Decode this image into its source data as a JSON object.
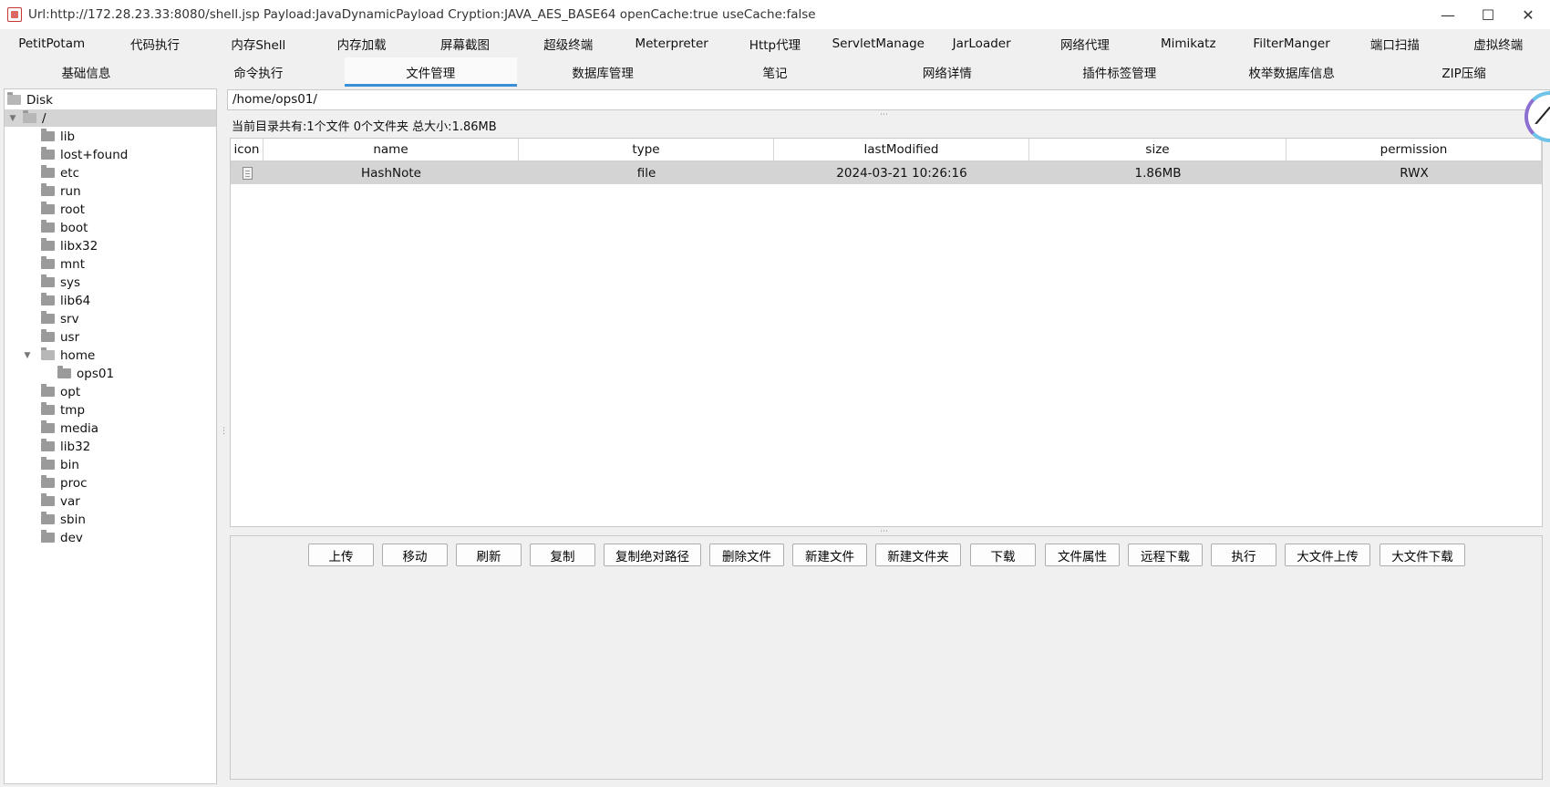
{
  "window": {
    "title": "Url:http://172.28.23.33:8080/shell.jsp Payload:JavaDynamicPayload Cryption:JAVA_AES_BASE64 openCache:true useCache:false"
  },
  "toolbar_row1": [
    "PetitPotam",
    "代码执行",
    "内存Shell",
    "内存加载",
    "屏幕截图",
    "超级终端",
    "Meterpreter",
    "Http代理",
    "ServletManage",
    "JarLoader",
    "网络代理",
    "Mimikatz",
    "FilterManger",
    "端口扫描",
    "虚拟终端"
  ],
  "toolbar_row2": [
    "基础信息",
    "命令执行",
    "文件管理",
    "数据库管理",
    "笔记",
    "网络详情",
    "插件标签管理",
    "枚举数据库信息",
    "ZIP压缩"
  ],
  "active_tab": "文件管理",
  "tree": {
    "root": "Disk",
    "slash": "/",
    "folders": [
      "lib",
      "lost+found",
      "etc",
      "run",
      "root",
      "boot",
      "libx32",
      "mnt",
      "sys",
      "lib64",
      "srv",
      "usr",
      "home",
      "ops01",
      "opt",
      "tmp",
      "media",
      "lib32",
      "bin",
      "proc",
      "var",
      "sbin",
      "dev"
    ]
  },
  "path": "/home/ops01/",
  "summary": "当前目录共有:1个文件 0个文件夹 总大小:1.86MB",
  "table": {
    "headers": [
      "icon",
      "name",
      "type",
      "lastModified",
      "size",
      "permission"
    ],
    "rows": [
      {
        "name": "HashNote",
        "type": "file",
        "lastModified": "2024-03-21 10:26:16",
        "size": "1.86MB",
        "permission": "RWX"
      }
    ]
  },
  "actions": [
    "上传",
    "移动",
    "刷新",
    "复制",
    "复制绝对路径",
    "删除文件",
    "新建文件",
    "新建文件夹",
    "下载",
    "文件属性",
    "远程下载",
    "执行",
    "大文件上传",
    "大文件下载"
  ]
}
